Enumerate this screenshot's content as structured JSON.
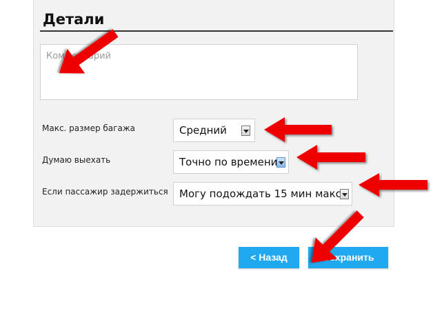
{
  "details": {
    "title": "Детали",
    "comment": {
      "placeholder": "Комментарий"
    },
    "fields": [
      {
        "label": "Макс. размер багажа",
        "value": "Средний"
      },
      {
        "label": "Думаю выехать",
        "value": "Точно по времени"
      },
      {
        "label": "Если пассажир задержиться",
        "value": "Могу подождать 15 мин макс."
      }
    ]
  },
  "actions": {
    "back_label": "< Назад",
    "save_label": "Сохранить"
  },
  "colors": {
    "button": "#20a9ee",
    "arrow": "#ee0000",
    "panel": "#f2f2f2"
  },
  "icons": {
    "annotation": "red-arrow-icon",
    "dropdown": "dropdown-arrow-icon"
  }
}
